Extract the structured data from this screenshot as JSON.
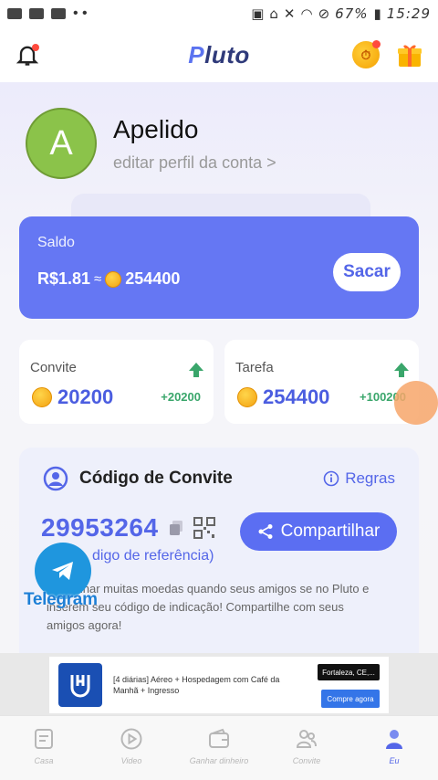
{
  "status_bar": {
    "battery": "67%",
    "time": "15:29"
  },
  "header": {
    "logo": "Pluto",
    "bell_icon": "bell-icon",
    "clock_icon": "clock-coin-icon",
    "gift_icon": "gift-icon"
  },
  "profile": {
    "avatar_letter": "A",
    "nickname": "Apelido",
    "edit_link": "editar perfil da conta >"
  },
  "balance": {
    "label": "Saldo",
    "amount": "R$1.81",
    "approx": "≈",
    "coins": "254400",
    "withdraw_button": "Sacar"
  },
  "stats": {
    "invite": {
      "title": "Convite",
      "value": "20200",
      "delta": "+20200"
    },
    "task": {
      "title": "Tarefa",
      "value": "254400",
      "delta": "+100200"
    }
  },
  "invite_code": {
    "title": "Código de Convite",
    "rules": "Regras",
    "code": "29953264",
    "share_button": "Compartilhar",
    "ref_label": "digo de referência)",
    "description": "de ganhar muitas moedas quando seus amigos se no Pluto e inserem seu código de indicação! Compartilhe com seus amigos agora!"
  },
  "telegram": {
    "label": "Telegram"
  },
  "ad": {
    "text": "[4 diárias] Aéreo + Hospedagem com Café da Manhã + Ingresso",
    "location": "Fortaleza, CE,...",
    "cta": "Compre agora"
  },
  "bottom_nav": {
    "items": [
      {
        "label": "Casa",
        "icon": "home-doc-icon"
      },
      {
        "label": "Video",
        "icon": "play-icon"
      },
      {
        "label": "Ganhar dinheiro",
        "icon": "wallet-icon"
      },
      {
        "label": "Convite",
        "icon": "users-icon"
      },
      {
        "label": "Eu",
        "icon": "person-icon"
      }
    ],
    "active_index": 4
  },
  "colors": {
    "accent": "#5b6ef2",
    "balance_card": "#6577f3",
    "positive": "#3aa66b",
    "telegram": "#1f96de"
  }
}
